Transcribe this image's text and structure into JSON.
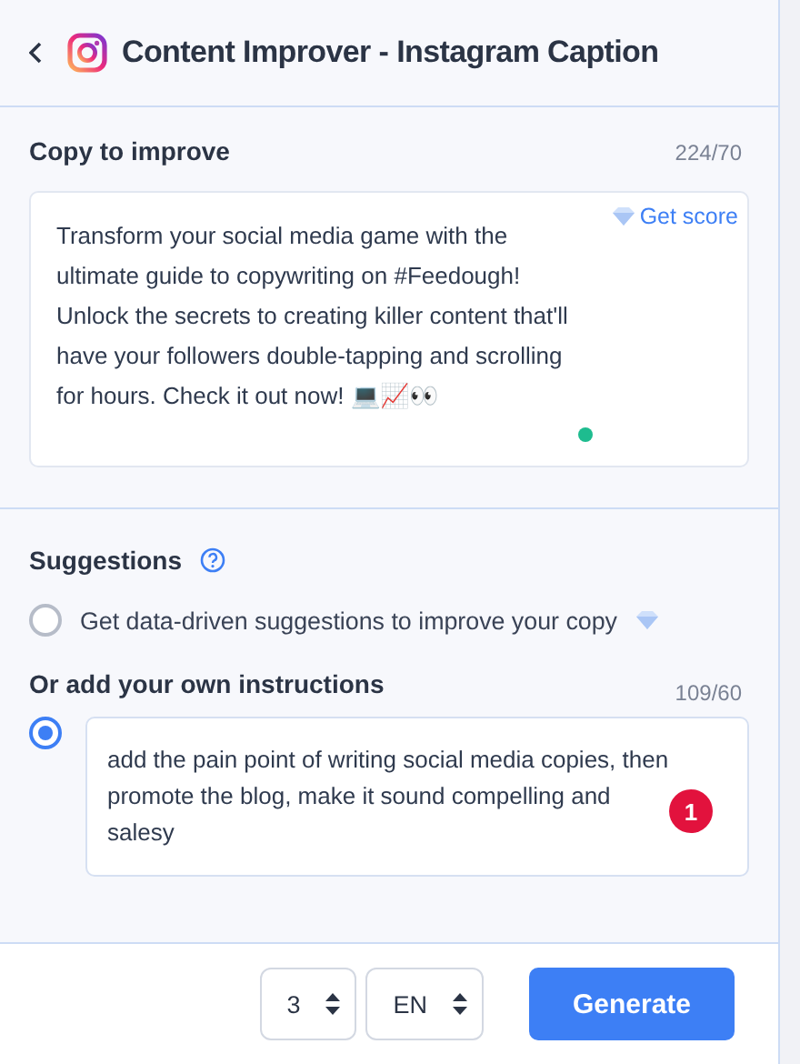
{
  "header": {
    "title": "Content Improver - Instagram Caption"
  },
  "copy": {
    "label": "Copy to improve",
    "count": "224/70",
    "score_link": "Get score",
    "value": "Transform your social media game with the ultimate guide to copywriting on #Feedough! Unlock the secrets to creating killer content that'll have your followers double-tapping and scrolling for hours. Check it out now! 💻📈👀"
  },
  "suggestions": {
    "label": "Suggestions",
    "options": [
      {
        "kind": "auto",
        "label": "Get data-driven suggestions to improve your copy",
        "selected": false
      },
      {
        "kind": "custom",
        "label": "Or add your own instructions",
        "count": "109/60",
        "value": "add the pain point of writing social media copies, then promote the blog, make it sound compelling and salesy",
        "badge": "1",
        "selected": true
      }
    ]
  },
  "footer": {
    "count_select": "3",
    "language_select": "EN",
    "generate_button": "Generate"
  }
}
